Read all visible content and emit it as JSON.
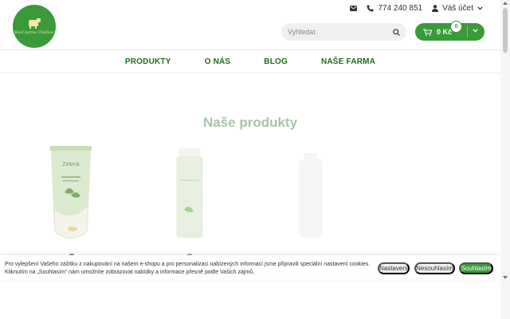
{
  "header": {
    "logo_text": "Kozí farma Únětice",
    "phone": "774 240 851",
    "account_label": "Váš účet",
    "search_placeholder": "Vyhledat",
    "cart_total": "0 Kč",
    "cart_count": "0"
  },
  "nav": {
    "items": [
      "PRODUKTY",
      "O NÁS",
      "BLOG",
      "NAŠE FARMA"
    ]
  },
  "main": {
    "section_title": "Naše produkty",
    "product_label": "Zelená"
  },
  "cookie": {
    "text": "Pro vylepšení Vašeho zážitku z nakupování na našem e-shopu a pro personalizaci nabízených informací jsme připravili speciální nastavení cookies. Kliknutím na „Souhlasím“ nám umožníte zobrazovat nabídky a informace přesně podle Vašich zájmů.",
    "settings_label": "Nastavení",
    "decline_label": "Nesouhlasím",
    "accept_label": "Souhlasím"
  },
  "colors": {
    "brand_green": "#3a9a3a",
    "nav_green": "#1f6b1f",
    "title_green": "#a9c4a9"
  },
  "icons": [
    "envelope-icon",
    "phone-icon",
    "user-icon",
    "chevron-down-icon",
    "search-icon",
    "cart-icon"
  ]
}
